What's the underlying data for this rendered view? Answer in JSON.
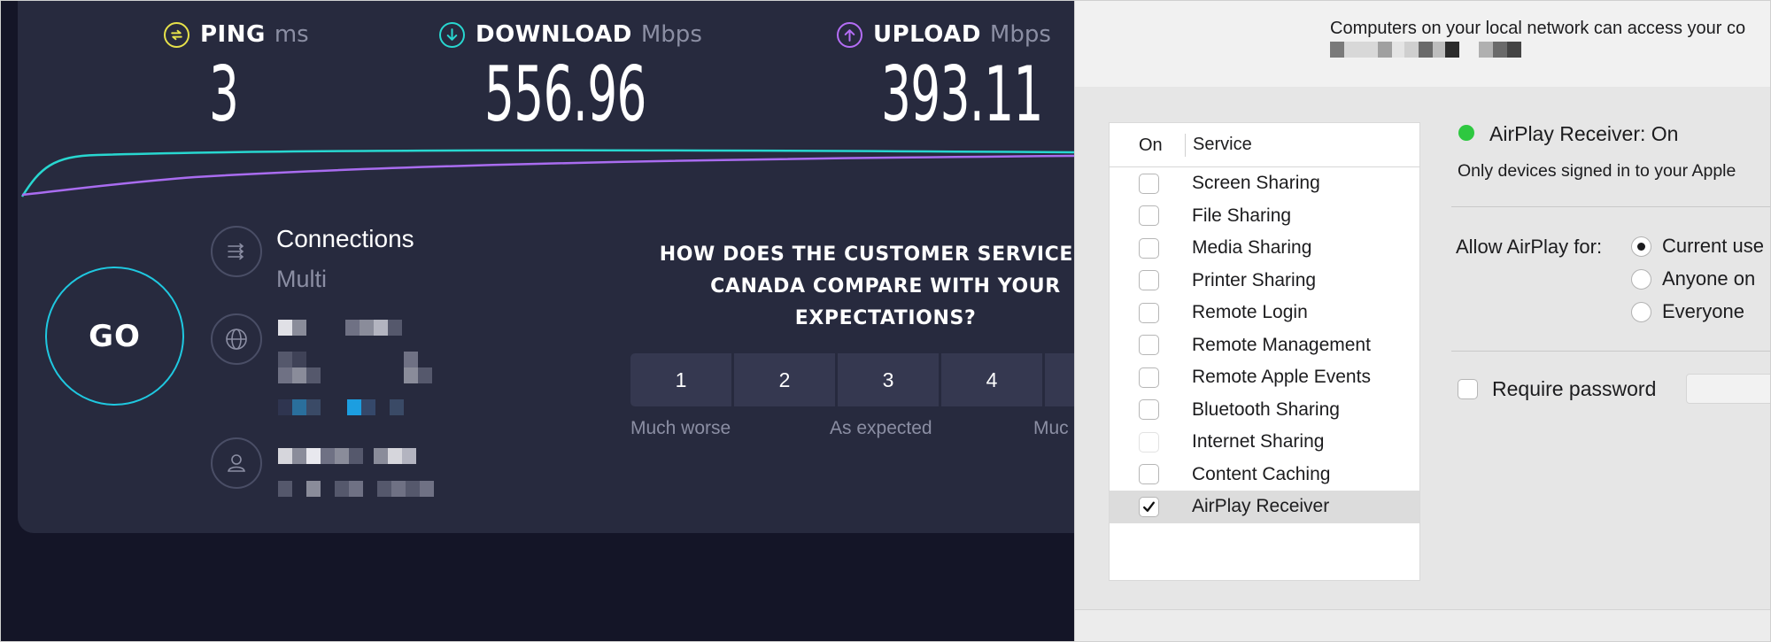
{
  "speedtest": {
    "ping": {
      "label": "PING",
      "unit": "ms",
      "value": "3",
      "color": "#e6e14a"
    },
    "download": {
      "label": "DOWNLOAD",
      "unit": "Mbps",
      "value": "556.96",
      "color": "#28d7d0"
    },
    "upload": {
      "label": "UPLOAD",
      "unit": "Mbps",
      "value": "393.11",
      "color": "#b46df5"
    },
    "go_label": "GO",
    "connections": {
      "title": "Connections",
      "value": "Multi"
    },
    "survey": {
      "question": "HOW DOES THE CUSTOMER SERVICE OF CANADA COMPARE WITH YOUR EXPECTATIONS?",
      "ratings": [
        "1",
        "2",
        "3",
        "4"
      ],
      "captions": {
        "left": "Much worse",
        "middle": "As expected",
        "right": "Muc"
      }
    }
  },
  "sharing": {
    "network_note": "Computers on your local network can access your co",
    "list_header": {
      "on": "On",
      "service": "Service"
    },
    "services": [
      {
        "label": "Screen Sharing",
        "checked": false
      },
      {
        "label": "File Sharing",
        "checked": false
      },
      {
        "label": "Media Sharing",
        "checked": false
      },
      {
        "label": "Printer Sharing",
        "checked": false
      },
      {
        "label": "Remote Login",
        "checked": false
      },
      {
        "label": "Remote Management",
        "checked": false
      },
      {
        "label": "Remote Apple Events",
        "checked": false
      },
      {
        "label": "Bluetooth Sharing",
        "checked": false
      },
      {
        "label": "Internet Sharing",
        "checked": false
      },
      {
        "label": "Content Caching",
        "checked": false
      },
      {
        "label": "AirPlay Receiver",
        "checked": true
      }
    ],
    "status": {
      "title": "AirPlay Receiver: On",
      "description": "Only devices signed in to your Apple",
      "color": "#2ec840"
    },
    "allow": {
      "label": "Allow AirPlay for:",
      "options": [
        "Current use",
        "Anyone on",
        "Everyone"
      ],
      "selected": "Current use"
    },
    "require_password": {
      "label": "Require password",
      "checked": false
    }
  }
}
